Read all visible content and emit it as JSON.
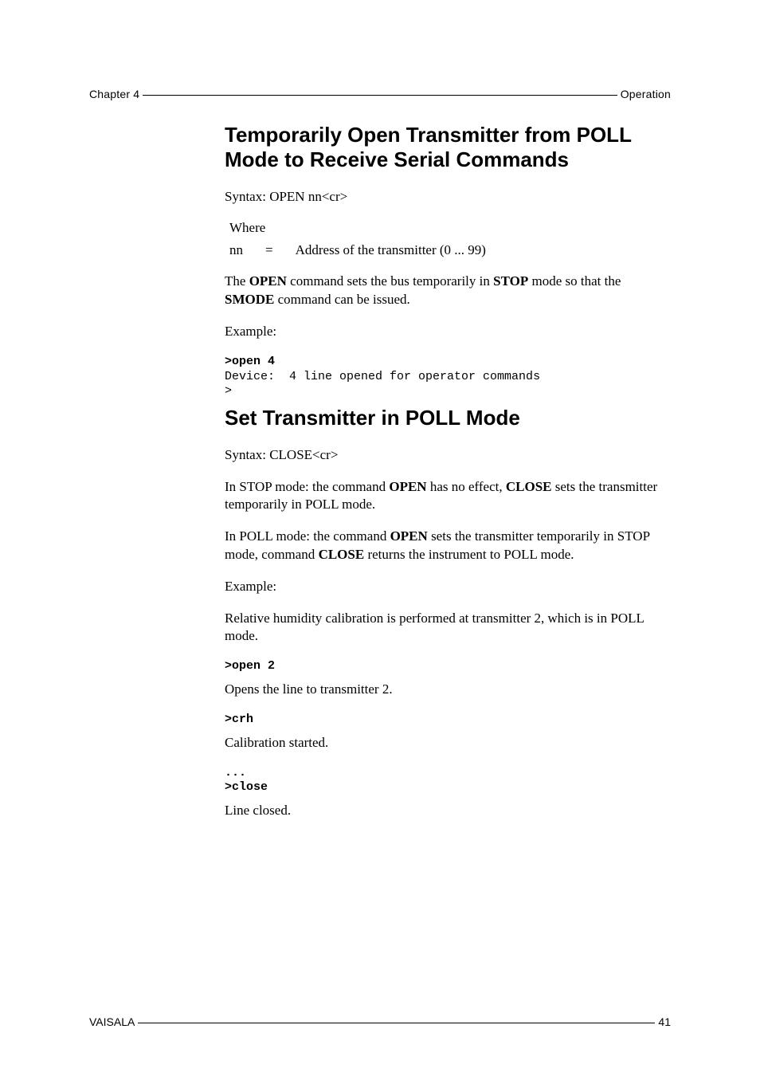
{
  "header": {
    "left": "Chapter 4",
    "right": "Operation"
  },
  "section1": {
    "title": "Temporarily Open Transmitter from POLL Mode to Receive Serial Commands",
    "syntax": "Syntax: OPEN nn<cr>",
    "where_label": "Where",
    "param_name": "nn",
    "param_eq": "=",
    "param_desc": "Address of the transmitter (0 ... 99)",
    "desc_pre": "The ",
    "desc_b1": "OPEN",
    "desc_mid1": " command sets the bus temporarily in ",
    "desc_b2": "STOP",
    "desc_mid2": " mode so that the ",
    "desc_b3": "SMODE",
    "desc_post": " command can be issued.",
    "example_label": "Example:",
    "code_cmd": ">open 4",
    "code_out": "Device:  4 line opened for operator commands\n>"
  },
  "section2": {
    "title": "Set Transmitter in POLL Mode",
    "syntax": "Syntax: CLOSE<cr>",
    "p1_pre": "In STOP mode: the command ",
    "p1_b1": "OPEN",
    "p1_mid": " has no effect, ",
    "p1_b2": "CLOSE",
    "p1_post": " sets the transmitter temporarily in POLL mode.",
    "p2_pre": "In POLL mode: the command ",
    "p2_b1": "OPEN",
    "p2_mid": " sets the transmitter temporarily in STOP mode, command ",
    "p2_b2": "CLOSE",
    "p2_post": " returns the instrument to POLL mode.",
    "example_label": "Example:",
    "p3": "Relative humidity calibration is performed at transmitter 2, which is in POLL mode.",
    "code1": ">open 2",
    "p4": "Opens the line to transmitter 2.",
    "code2": ">crh",
    "p5": "Calibration started.",
    "code3": "...\n>close",
    "p6": "Line closed."
  },
  "footer": {
    "left": "VAISALA",
    "right": "41"
  }
}
